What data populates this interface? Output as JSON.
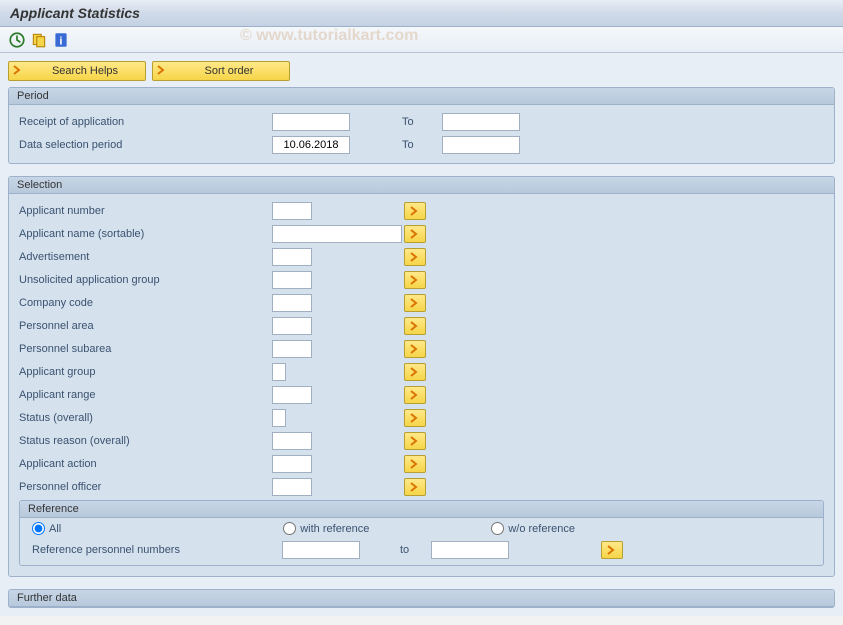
{
  "title": "Applicant Statistics",
  "watermark": "© www.tutorialkart.com",
  "buttons": {
    "search_helps": "Search Helps",
    "sort_order": "Sort order"
  },
  "period": {
    "title": "Period",
    "receipt_label": "Receipt of application",
    "receipt_from": "",
    "receipt_to_label": "To",
    "receipt_to": "",
    "data_sel_label": "Data selection period",
    "data_sel_from": "10.06.2018",
    "data_sel_to_label": "To",
    "data_sel_to": ""
  },
  "selection": {
    "title": "Selection",
    "rows": [
      {
        "label": "Applicant number",
        "size": "sm",
        "value": ""
      },
      {
        "label": "Applicant name (sortable)",
        "size": "lg",
        "value": ""
      },
      {
        "label": "Advertisement",
        "size": "sm",
        "value": ""
      },
      {
        "label": "Unsolicited application group",
        "size": "sm",
        "value": ""
      },
      {
        "label": "Company code",
        "size": "sm",
        "value": ""
      },
      {
        "label": "Personnel area",
        "size": "sm",
        "value": ""
      },
      {
        "label": "Personnel subarea",
        "size": "sm",
        "value": ""
      },
      {
        "label": "Applicant group",
        "size": "xs",
        "value": ""
      },
      {
        "label": "Applicant range",
        "size": "sm",
        "value": ""
      },
      {
        "label": "Status (overall)",
        "size": "xs",
        "value": ""
      },
      {
        "label": "Status reason (overall)",
        "size": "sm",
        "value": ""
      },
      {
        "label": "Applicant action",
        "size": "sm",
        "value": ""
      },
      {
        "label": "Personnel officer",
        "size": "sm",
        "value": ""
      }
    ]
  },
  "reference": {
    "title": "Reference",
    "opt_all": "All",
    "opt_with": "with reference",
    "opt_without": "w/o reference",
    "ref_pers_label": "Reference personnel numbers",
    "ref_from": "",
    "ref_to_label": "to",
    "ref_to": ""
  },
  "further": {
    "title": "Further data"
  }
}
